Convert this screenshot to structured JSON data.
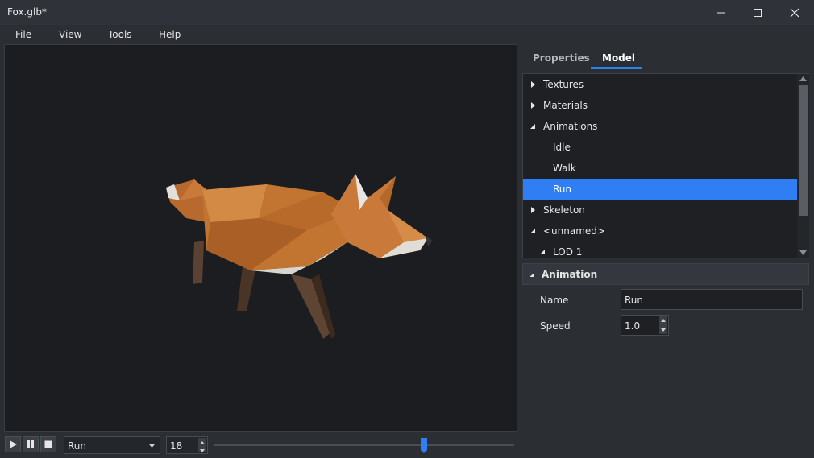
{
  "window": {
    "title": "Fox.glb*"
  },
  "menu": {
    "items": [
      "File",
      "View",
      "Tools",
      "Help"
    ]
  },
  "playback": {
    "animation_select": "Run",
    "frame": "18",
    "timeline_position": 0.7
  },
  "tabs": {
    "items": [
      "Properties",
      "Model"
    ],
    "active": "Model"
  },
  "tree": {
    "items": [
      {
        "label": "Textures",
        "expanded": false,
        "level": 0
      },
      {
        "label": "Materials",
        "expanded": false,
        "level": 0
      },
      {
        "label": "Animations",
        "expanded": true,
        "level": 0
      },
      {
        "label": "Idle",
        "level": 1
      },
      {
        "label": "Walk",
        "level": 1
      },
      {
        "label": "Run",
        "level": 1,
        "selected": true
      },
      {
        "label": "Skeleton",
        "expanded": false,
        "level": 0
      },
      {
        "label": "<unnamed>",
        "expanded": true,
        "level": 0
      },
      {
        "label": "LOD 1",
        "expanded": true,
        "level": 1
      }
    ]
  },
  "animation_panel": {
    "header": "Animation",
    "name_label": "Name",
    "name_value": "Run",
    "speed_label": "Speed",
    "speed_value": "1.0"
  },
  "colors": {
    "accent": "#2f7ef3",
    "fox_orange": "#c97a3a"
  }
}
